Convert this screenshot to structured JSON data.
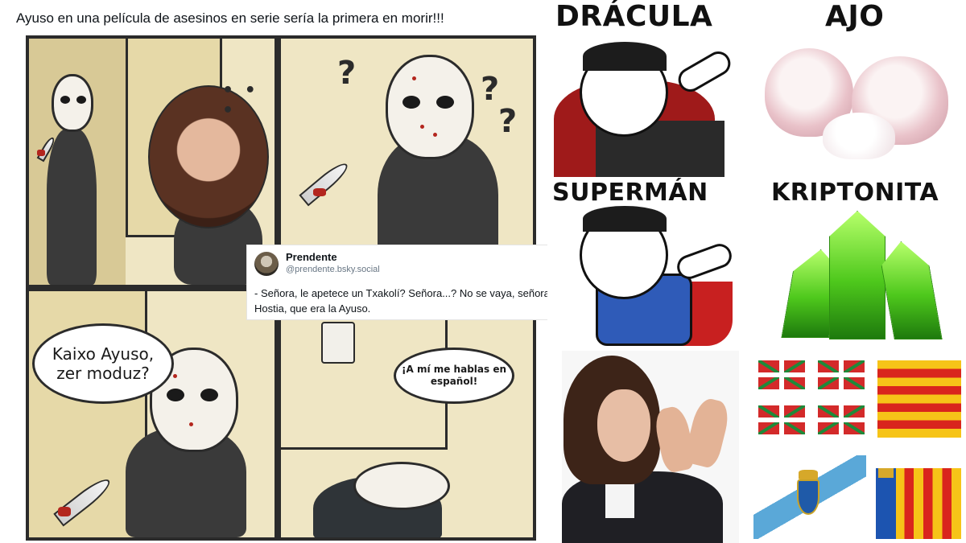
{
  "tweet": {
    "text": "Ayuso en una película de asesinos en serie sería la primera en morir!!!"
  },
  "comic": {
    "panel1_dots": "• • •",
    "panel2_q1": "?",
    "panel2_q2": "?",
    "panel2_q3": "?",
    "bubble_left": "Kaixo Ayuso,\nzer moduz?",
    "bubble_right": "¡A mí me hablas en\nespañol!"
  },
  "embedded_post": {
    "author_name": "Prendente",
    "author_handle": "@prendente.bsky.social",
    "text": "- Señora, le apetece un Txakolí? Señora...? No se vaya, señora. Hostia, que era la Ayuso."
  },
  "meme": {
    "label_dracula": "DRÁCULA",
    "label_ajo": "AJO",
    "label_superman": "SUPERMÁN",
    "label_kriptonita": "KRIPTONITA"
  },
  "colors": {
    "comic_bg": "#efe6c4",
    "ink": "#2b2b2b",
    "blood": "#b3261e",
    "kryptonite": "#4ec81c",
    "cape_red": "#9f1a1a",
    "super_blue": "#2f5bb8"
  }
}
